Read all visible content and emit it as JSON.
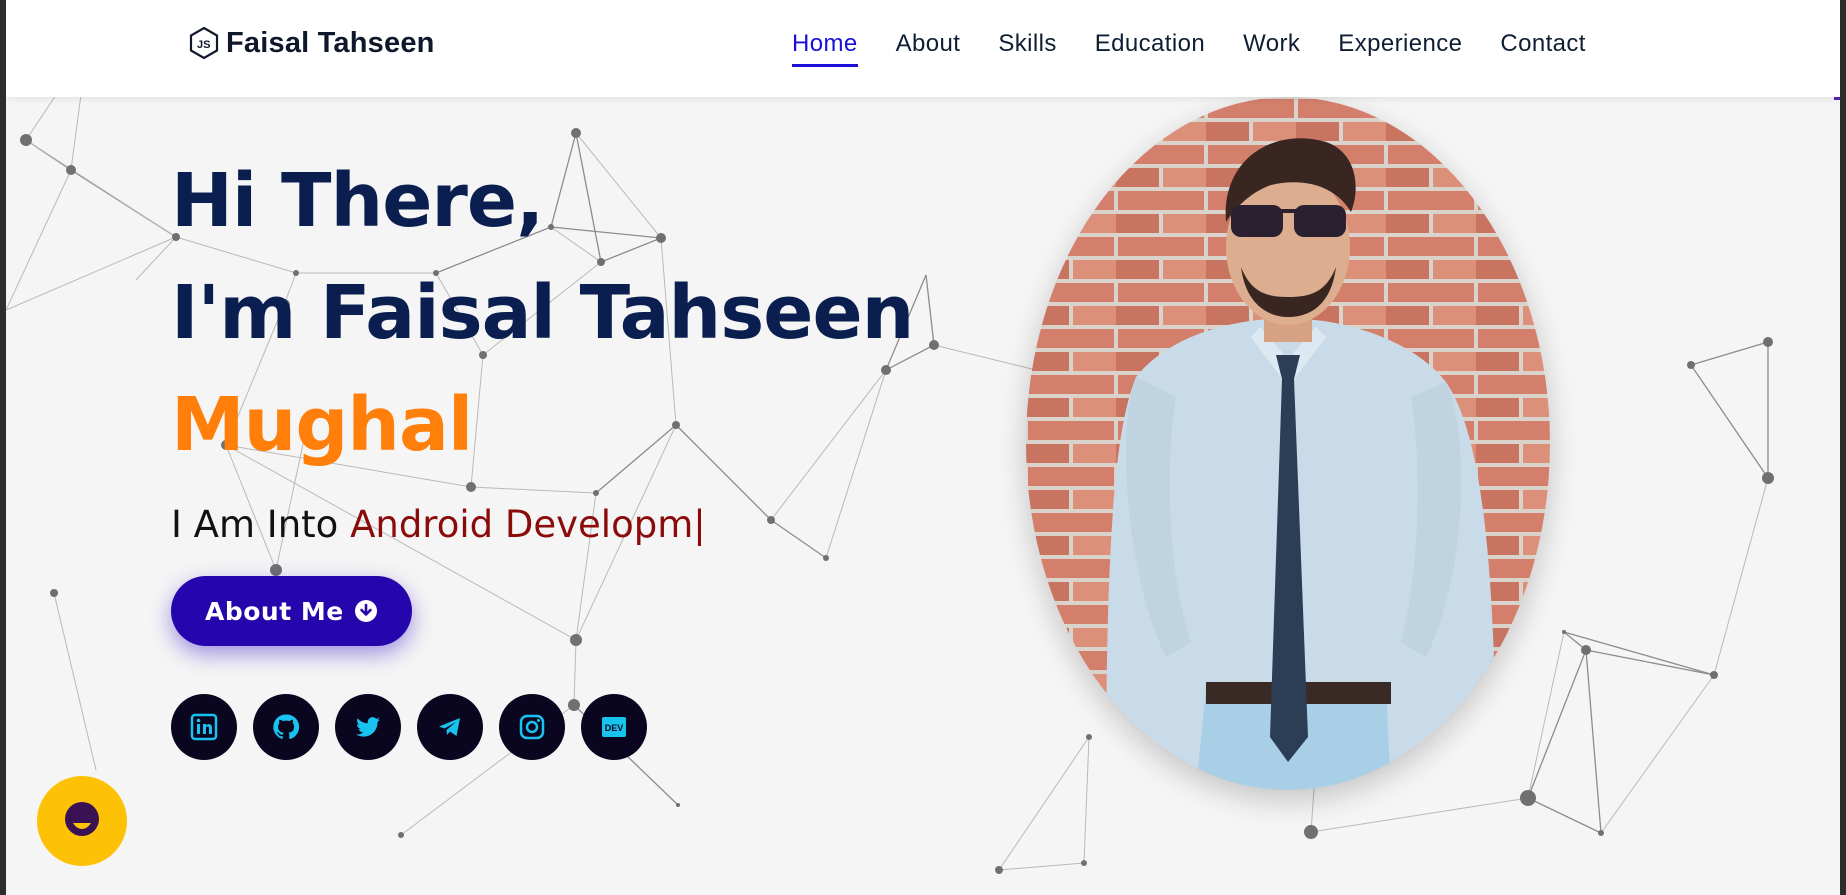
{
  "header": {
    "brand": "Faisal Tahseen",
    "nav": [
      {
        "label": "Home",
        "active": true
      },
      {
        "label": "About"
      },
      {
        "label": "Skills"
      },
      {
        "label": "Education"
      },
      {
        "label": "Work"
      },
      {
        "label": "Experience"
      },
      {
        "label": "Contact"
      }
    ]
  },
  "hero": {
    "line1": "Hi There,",
    "line2": "I'm Faisal Tahseen",
    "line3": "Mughal",
    "into_prefix": "I Am Into ",
    "into_typed": "Android Developm|",
    "button_label": "About Me",
    "socials": [
      {
        "name": "linkedin-icon"
      },
      {
        "name": "github-icon"
      },
      {
        "name": "twitter-icon"
      },
      {
        "name": "telegram-icon"
      },
      {
        "name": "instagram-icon"
      },
      {
        "name": "dev-icon",
        "text": "DEV"
      }
    ]
  },
  "colors": {
    "navy": "#0a1f4f",
    "orange": "#ff7f0a",
    "typed": "#8b0b0b",
    "button": "#2506ad",
    "nav_active": "#1a0fd6",
    "social_bg": "#0b0620",
    "social_icon": "#19c3f0",
    "chat": "#fdc106"
  }
}
